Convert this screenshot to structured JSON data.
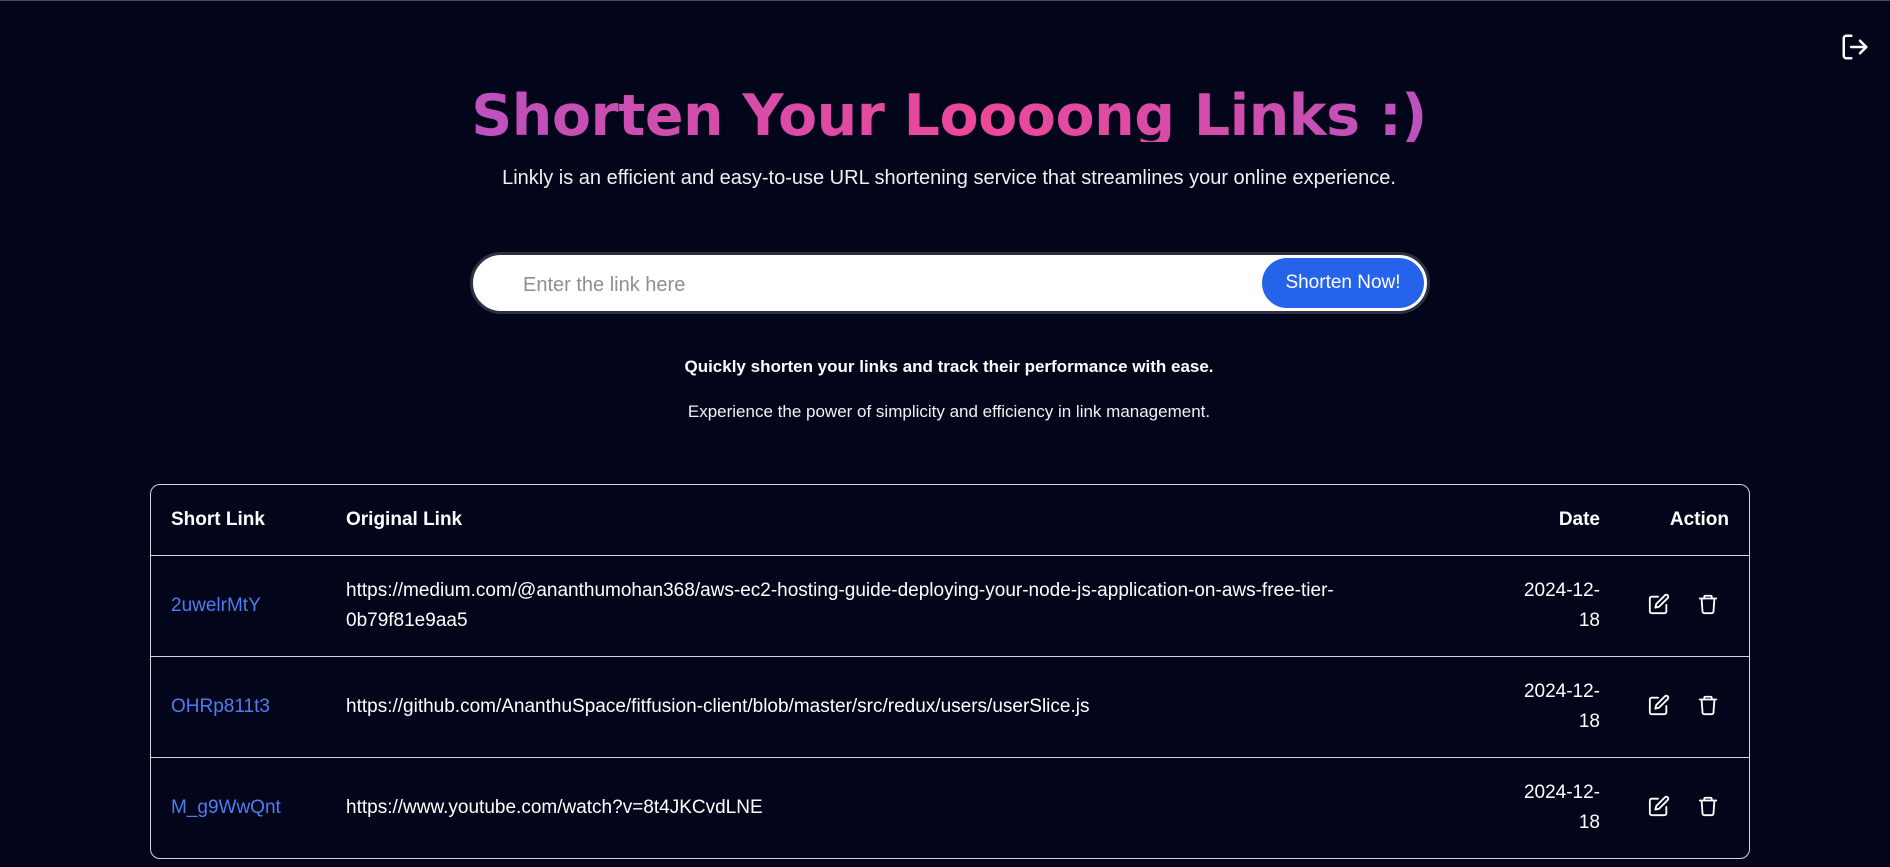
{
  "header": {
    "logout_icon": "logout-icon"
  },
  "hero": {
    "title": "Shorten Your Loooong Links :)",
    "subtitle": "Linkly is an efficient and easy-to-use URL shortening service that streamlines your online experience."
  },
  "form": {
    "placeholder": "Enter the link here",
    "value": "",
    "button_label": "Shorten Now!"
  },
  "taglines": {
    "primary": "Quickly shorten your links and track their performance with ease.",
    "secondary": "Experience the power of simplicity and efficiency in link management."
  },
  "table": {
    "headers": {
      "short": "Short Link",
      "original": "Original Link",
      "date": "Date",
      "action": "Action"
    },
    "rows": [
      {
        "short": "2uwelrMtY",
        "original": "https://medium.com/@ananthumohan368/aws-ec2-hosting-guide-deploying-your-node-js-application-on-aws-free-tier-0b79f81e9aa5",
        "date_line1": "2024-12-",
        "date_line2": "18"
      },
      {
        "short": "OHRp811t3",
        "original": "https://github.com/AnanthuSpace/fitfusion-client/blob/master/src/redux/users/userSlice.js",
        "date_line1": "2024-12-",
        "date_line2": "18"
      },
      {
        "short": "M_g9WwQnt",
        "original": "https://www.youtube.com/watch?v=8t4JKCvdLNE",
        "date_line1": "2024-12-",
        "date_line2": "18"
      }
    ],
    "action_icons": [
      "edit-icon",
      "trash-icon"
    ]
  },
  "colors": {
    "background": "#03061a",
    "accent_button": "#2563eb",
    "link": "#4f7cf0",
    "title_gradient_start": "#8b5cf6",
    "title_gradient_mid": "#ec4899"
  }
}
